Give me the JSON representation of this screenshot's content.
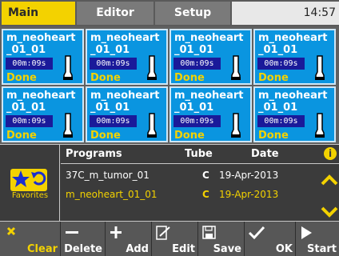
{
  "tabs": [
    {
      "label": "Main menu",
      "active": true
    },
    {
      "label": "Editor",
      "active": false
    },
    {
      "label": "Setup",
      "active": false
    }
  ],
  "clock": "14:57",
  "slots": [
    {
      "name": "m_neoheart\n_01_01",
      "timer": "00m:09s",
      "status": "Done"
    },
    {
      "name": "m_neoheart\n_01_01",
      "timer": "00m:09s",
      "status": "Done"
    },
    {
      "name": "m_neoheart\n_01_01",
      "timer": "00m:09s",
      "status": "Done"
    },
    {
      "name": "m_neoheart\n_01_01",
      "timer": "00m:09s",
      "status": "Done"
    },
    {
      "name": "m_neoheart\n_01_01",
      "timer": "00m:09s",
      "status": "Done"
    },
    {
      "name": "m_neoheart\n_01_01",
      "timer": "00m:09s",
      "status": "Done"
    },
    {
      "name": "m_neoheart\n_01_01",
      "timer": "00m:09s",
      "status": "Done"
    },
    {
      "name": "m_neoheart\n_01_01",
      "timer": "00m:09s",
      "status": "Done"
    }
  ],
  "favorites": {
    "label": "Favorites",
    "icon": "star-refresh-icon"
  },
  "programs": {
    "headers": {
      "name": "Programs",
      "tube": "Tube",
      "date": "Date"
    },
    "rows": [
      {
        "name": "37C_m_tumor_01",
        "tube": "C",
        "date": "19-Apr-2013",
        "selected": false
      },
      {
        "name": "m_neoheart_01_01",
        "tube": "C",
        "date": "19-Apr-2013",
        "selected": true
      }
    ]
  },
  "toolbar": {
    "clear": "Clear",
    "delete": "Delete",
    "add": "Add",
    "edit": "Edit",
    "save": "Save",
    "ok": "OK",
    "start": "Start"
  },
  "colors": {
    "accent": "#f3d200",
    "slot_bg": "#0a95e0",
    "timer_bg": "#1a1a9a",
    "background": "#3a3a3a"
  }
}
